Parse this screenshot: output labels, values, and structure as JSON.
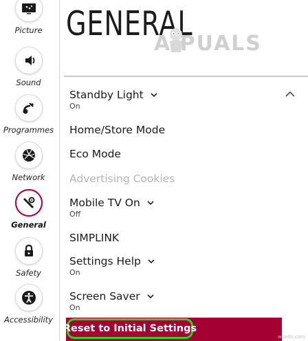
{
  "sidebar": {
    "items": [
      {
        "label": "Picture",
        "icon": "picture-icon"
      },
      {
        "label": "Sound",
        "icon": "sound-icon"
      },
      {
        "label": "Programmes",
        "icon": "programmes-icon"
      },
      {
        "label": "Network",
        "icon": "network-icon"
      },
      {
        "label": "General",
        "icon": "general-icon",
        "active": true
      },
      {
        "label": "Safety",
        "icon": "lock-icon"
      },
      {
        "label": "Accessibility",
        "icon": "accessibility-icon"
      }
    ]
  },
  "header": {
    "title": "GENERAL",
    "watermark": "A  PUALS"
  },
  "menu": {
    "items": [
      {
        "label": "Standby Light",
        "value": "On",
        "expandable": true
      },
      {
        "label": "Home/Store Mode"
      },
      {
        "label": "Eco Mode"
      },
      {
        "label": "Advertising Cookies",
        "disabled": true
      },
      {
        "label": "Mobile TV On",
        "value": "Off",
        "expandable": true
      },
      {
        "label": "SIMPLINK"
      },
      {
        "label": "Settings Help",
        "value": "On",
        "expandable": true
      },
      {
        "label": "Screen Saver",
        "value": "On",
        "expandable": true
      }
    ],
    "reset_label": "Reset to Initial Settings"
  },
  "credit": "wsxdn.com",
  "colors": {
    "accent": "#a50034",
    "highlight_ring": "#1fdc1f",
    "disabled_text": "#b5b5b5"
  }
}
